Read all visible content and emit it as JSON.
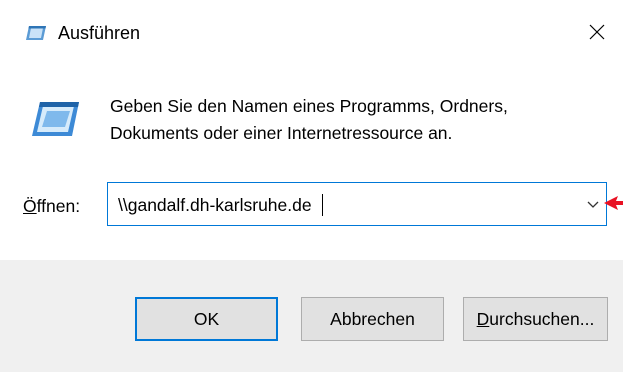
{
  "window": {
    "title": "Ausführen",
    "close_icon": "close-icon"
  },
  "message": {
    "line1": "Geben Sie den Namen eines Programms, Ordners,",
    "line2": "Dokuments oder einer Internetressource an."
  },
  "open_field": {
    "label_accel": "Ö",
    "label_rest": "ffnen:",
    "value": "\\\\gandalf.dh-karlsruhe.de"
  },
  "buttons": {
    "ok": "OK",
    "cancel": "Abbrechen",
    "browse_accel": "D",
    "browse_rest": "urchsuchen..."
  },
  "colors": {
    "accent": "#0078d7",
    "footer_bg": "#f0f0f0",
    "button_bg": "#e1e1e1",
    "pointer": "#e81123"
  }
}
